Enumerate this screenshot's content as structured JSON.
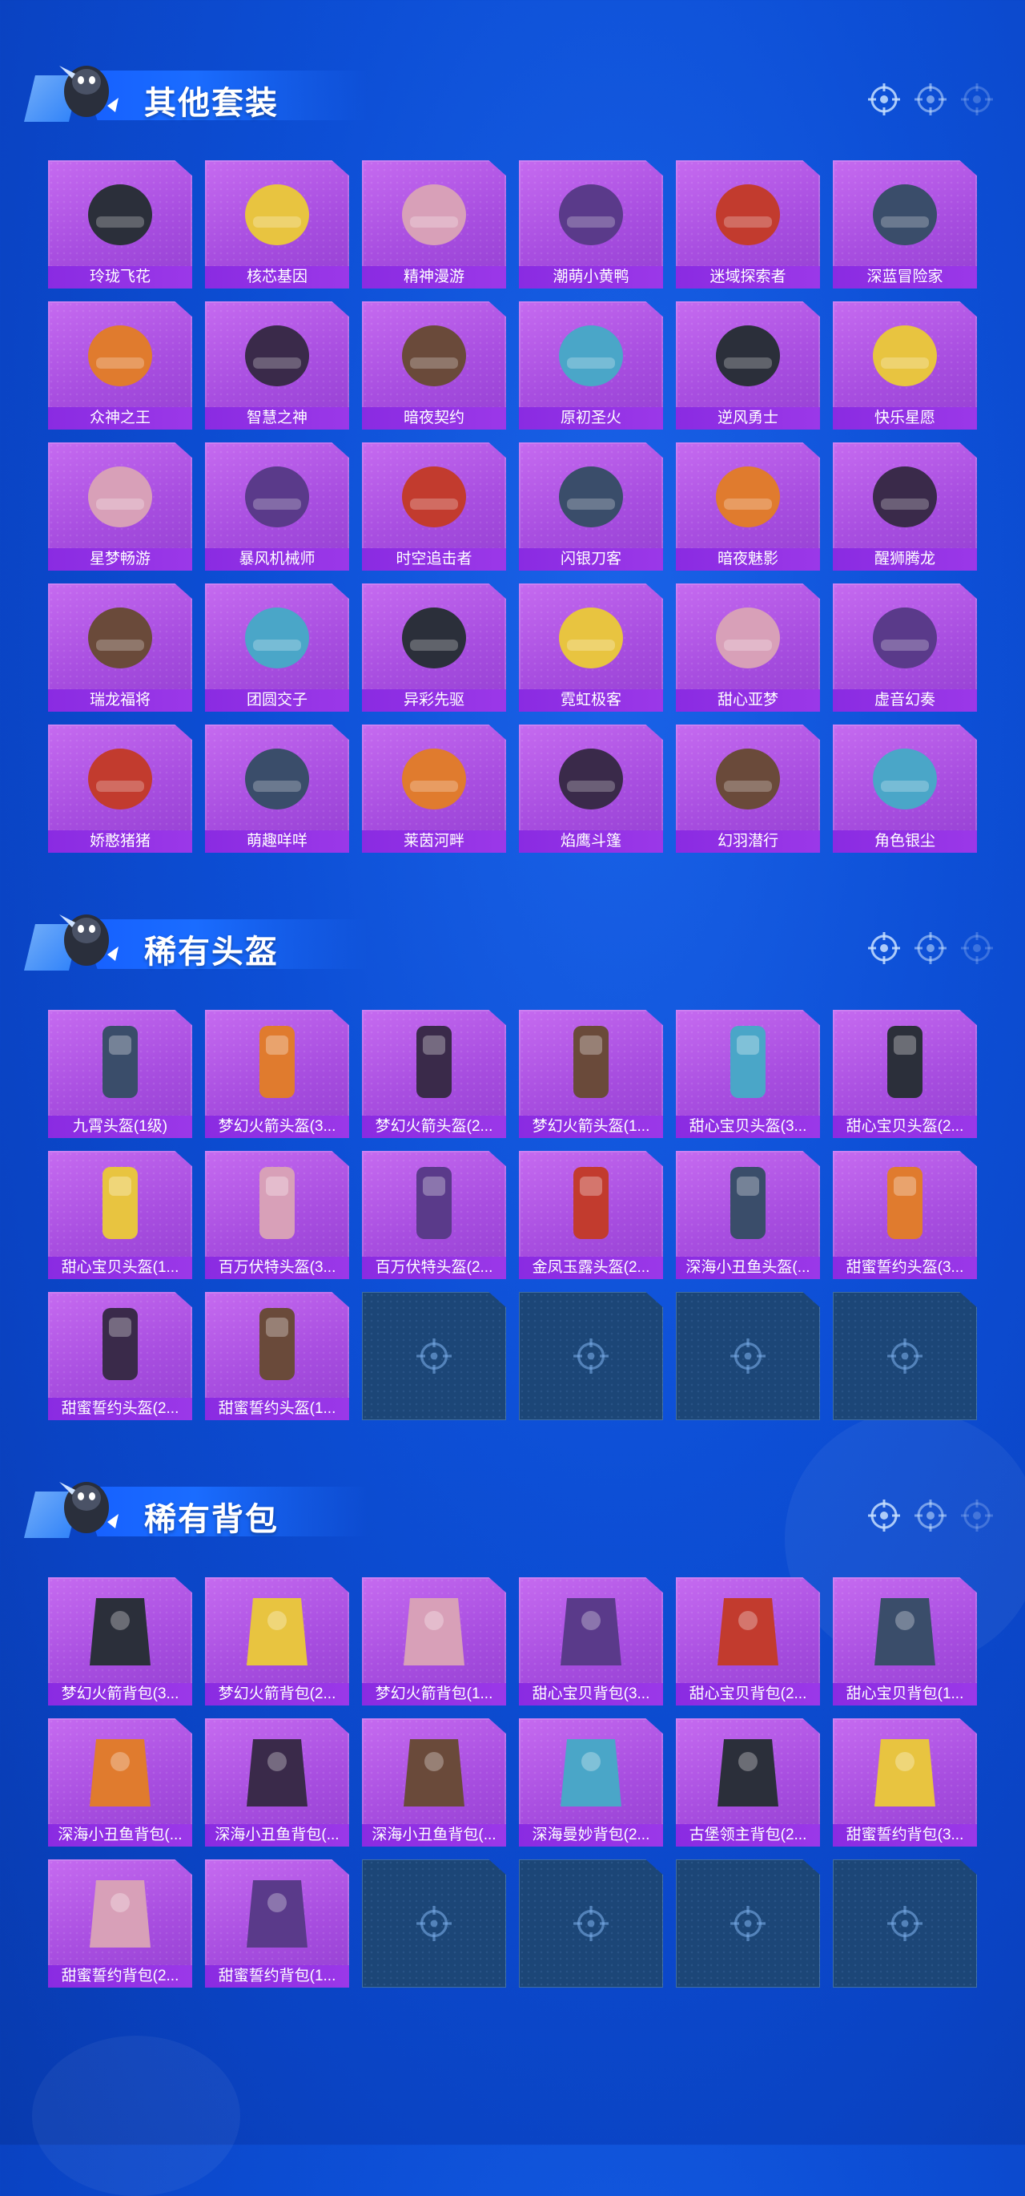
{
  "sections": [
    {
      "title": "其他套装",
      "items": [
        "玲珑飞花",
        "核芯基因",
        "精神漫游",
        "潮萌小黄鸭",
        "迷域探索者",
        "深蓝冒险家",
        "众神之王",
        "智慧之神",
        "暗夜契约",
        "原初圣火",
        "逆风勇士",
        "快乐星愿",
        "星梦畅游",
        "暴风机械师",
        "时空追击者",
        "闪银刀客",
        "暗夜魅影",
        "醒狮腾龙",
        "瑞龙福将",
        "团圆交子",
        "异彩先驱",
        "霓虹极客",
        "甜心亚梦",
        "虚音幻奏",
        "娇憨猪猪",
        "萌趣咩咩",
        "莱茵河畔",
        "焰鹰斗篷",
        "幻羽潜行",
        "角色银尘"
      ],
      "empty_slots": 0
    },
    {
      "title": "稀有头盔",
      "items": [
        "九霄头盔(1级)",
        "梦幻火箭头盔(3...",
        "梦幻火箭头盔(2...",
        "梦幻火箭头盔(1...",
        "甜心宝贝头盔(3...",
        "甜心宝贝头盔(2...",
        "甜心宝贝头盔(1...",
        "百万伏特头盔(3...",
        "百万伏特头盔(2...",
        "金凤玉露头盔(2...",
        "深海小丑鱼头盔(...",
        "甜蜜誓约头盔(3...",
        "甜蜜誓约头盔(2...",
        "甜蜜誓约头盔(1..."
      ],
      "empty_slots": 4
    },
    {
      "title": "稀有背包",
      "items": [
        "梦幻火箭背包(3...",
        "梦幻火箭背包(2...",
        "梦幻火箭背包(1...",
        "甜心宝贝背包(3...",
        "甜心宝贝背包(2...",
        "甜心宝贝背包(1...",
        "深海小丑鱼背包(...",
        "深海小丑鱼背包(...",
        "深海小丑鱼背包(...",
        "深海曼妙背包(2...",
        "古堡领主背包(2...",
        "甜蜜誓约背包(3...",
        "甜蜜誓约背包(2...",
        "甜蜜誓约背包(1..."
      ],
      "empty_slots": 4
    }
  ],
  "colors": {
    "accent": "#a84ee0",
    "label_bg": "#8a2be2",
    "empty_slot": "#1c4677"
  }
}
